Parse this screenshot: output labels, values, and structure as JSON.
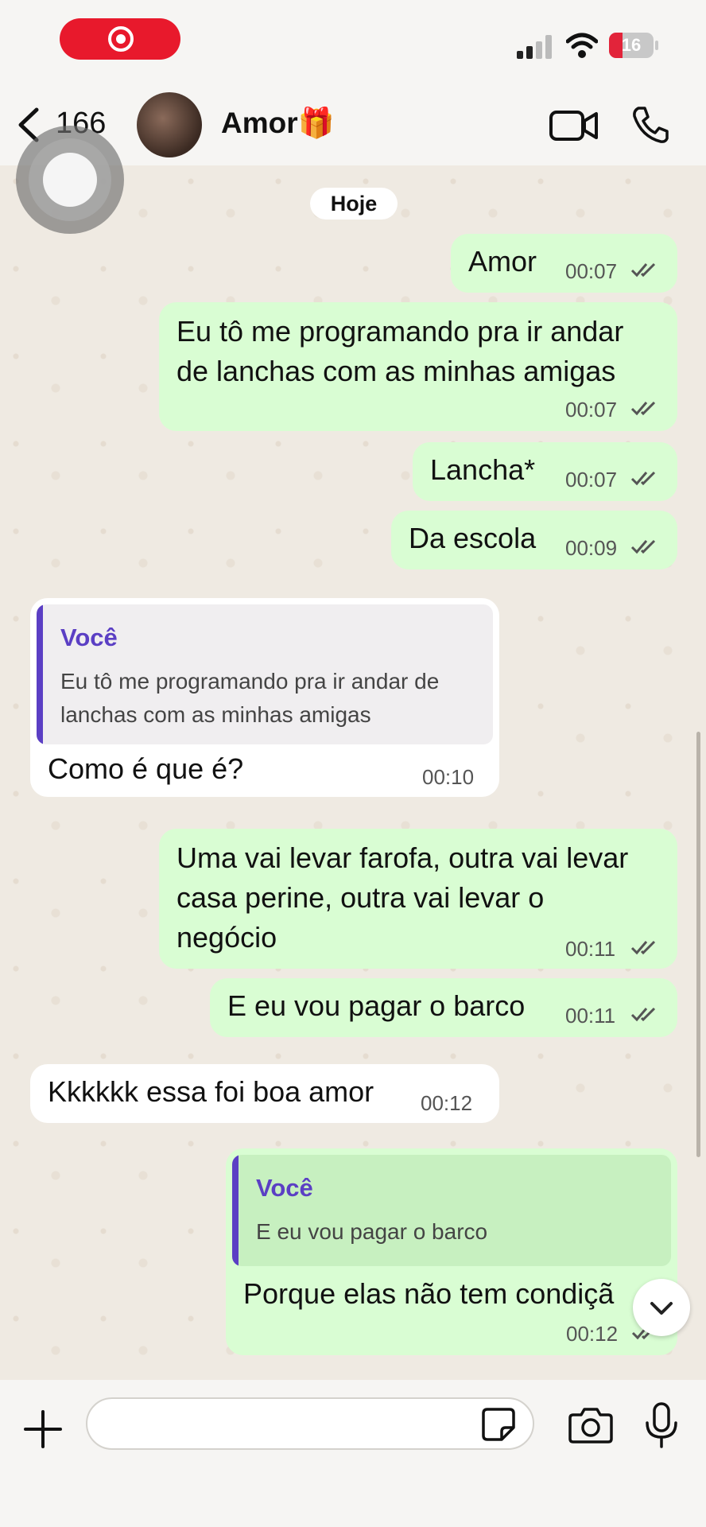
{
  "status": {
    "battery": "16"
  },
  "header": {
    "back_count": "166",
    "contact_name": "Amor🎁"
  },
  "chat": {
    "date_chip": "Hoje",
    "messages": [
      {
        "text": "Amor",
        "time": "00:07"
      },
      {
        "text": "Eu tô me programando pra ir andar de lanchas com as minhas amigas",
        "line1": "Eu tô me programando pra ir andar",
        "line2": "de lanchas com as minhas amigas",
        "time": "00:07"
      },
      {
        "text": "Lancha*",
        "time": "00:07"
      },
      {
        "text": "Da escola",
        "time": "00:09"
      },
      {
        "quote_name": "Você",
        "quote_line1": "Eu tô me programando pra ir andar de",
        "quote_line2": "lanchas com as minhas amigas",
        "text": "Como é que é?",
        "time": "00:10"
      },
      {
        "line1": "Uma vai levar farofa, outra vai levar",
        "line2": "casa perine, outra vai levar o",
        "line3": "negócio",
        "time": "00:11"
      },
      {
        "text": "E eu vou pagar o barco",
        "time": "00:11"
      },
      {
        "text": "Kkkkkk essa foi boa amor",
        "time": "00:12"
      },
      {
        "quote_name": "Você",
        "quote_text": "E eu vou pagar o barco",
        "text": "Porque elas não tem condiçã",
        "time": "00:12"
      }
    ]
  },
  "colors": {
    "outgoing": "#d9fdd3",
    "incoming": "#ffffff",
    "accent_quote": "#5b3fc4",
    "record_pill": "#e8192c"
  },
  "icons": [
    "record-icon",
    "signal-icon",
    "wifi-icon",
    "battery-icon",
    "back-chevron-icon",
    "video-call-icon",
    "phone-icon",
    "double-check-icon",
    "scroll-down-icon",
    "plus-icon",
    "sticker-icon",
    "camera-icon",
    "mic-icon"
  ]
}
